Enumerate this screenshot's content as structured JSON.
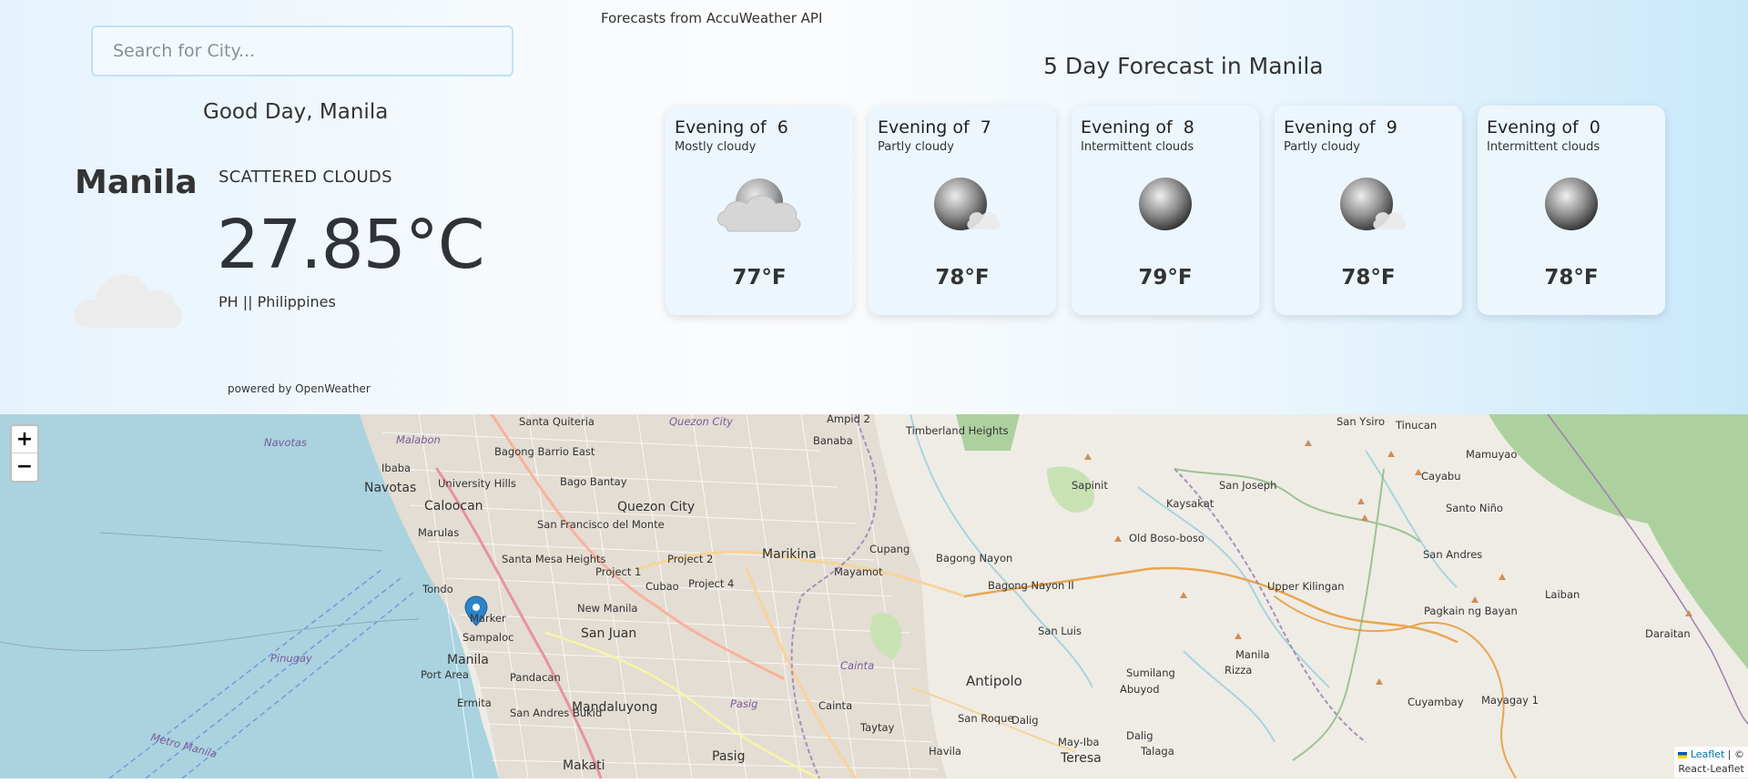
{
  "header": {
    "search_placeholder": "Search for City...",
    "api_note": "Forecasts from AccuWeather API",
    "greeting": "Good Day, Manila"
  },
  "current": {
    "city": "Manila",
    "condition": "SCATTERED CLOUDS",
    "temperature": "27.85°C",
    "country": "PH || Philippines",
    "icon": "cloud-icon",
    "powered_by": "powered by OpenWeather"
  },
  "forecast": {
    "title": "5 Day Forecast in Manila",
    "days": [
      {
        "day": "Evening of  6",
        "text": "Mostly cloudy",
        "temp": "77°F",
        "icon": "mostly-cloudy-night-icon"
      },
      {
        "day": "Evening of  7",
        "text": "Partly cloudy",
        "temp": "78°F",
        "icon": "partly-cloudy-night-icon"
      },
      {
        "day": "Evening of  8",
        "text": "Intermittent clouds",
        "temp": "79°F",
        "icon": "moon-icon"
      },
      {
        "day": "Evening of  9",
        "text": "Partly cloudy",
        "temp": "78°F",
        "icon": "partly-cloudy-night-icon"
      },
      {
        "day": "Evening of  0",
        "text": "Intermittent clouds",
        "temp": "78°F",
        "icon": "moon-icon"
      }
    ]
  },
  "map": {
    "zoom_in": "+",
    "zoom_out": "−",
    "attribution_link": "Leaflet",
    "attribution_rest": " | ©",
    "attribution_line2": "React-Leaflet",
    "labels": [
      "Santa Quiteria",
      "Quezon City",
      "Ampid 2",
      "Timberland Heights",
      "San Ysiro",
      "Tinucan",
      "Navotas",
      "Malabon",
      "Ibaba",
      "Bagong Barrio East",
      "Banaba",
      "Mamuyao",
      "Navotas",
      "University Hills",
      "Bago Bantay",
      "Sapinit",
      "San Joseph",
      "Cayabu",
      "Caloocan",
      "Quezon City",
      "Kaysakat",
      "Santo Niño",
      "Marulas",
      "San Francisco del Monte",
      "Marikina",
      "Cupang",
      "Bagong Nayon",
      "Old Boso-boso",
      "San Andres",
      "Santa Mesa Heights",
      "Project 2",
      "Project 1",
      "Mayamot",
      "Laiban",
      "Tondo",
      "Cubao",
      "Project 4",
      "Bagong Nayon II",
      "Upper Kilingan",
      "Pagkain ng Bayan",
      "Marker",
      "New Manila",
      "San Luis",
      "Daraitan",
      "Sampaloc",
      "San Juan",
      "Manila",
      "Pinugay",
      "Manila",
      "Pandacan",
      "Antipolo",
      "Sumilang",
      "Rizza",
      "Port Area",
      "Cainta",
      "Abuyod",
      "Cuyambay",
      "Mayagay 1",
      "Ermita",
      "San Andres Bukid",
      "Mandaluyong",
      "Pasig",
      "Cainta",
      "San Roque",
      "Dalig",
      "Metro Manila",
      "Taytay",
      "May-Iba",
      "Dalig",
      "Havila",
      "Talaga",
      "Teresa",
      "Makati",
      "Pasig"
    ]
  },
  "colors": {
    "card_bg": "#edf6fd",
    "water": "#aad3df",
    "forest": "#add19e",
    "border_purple": "#9e7fb3",
    "road_orange": "#e8a64f"
  }
}
